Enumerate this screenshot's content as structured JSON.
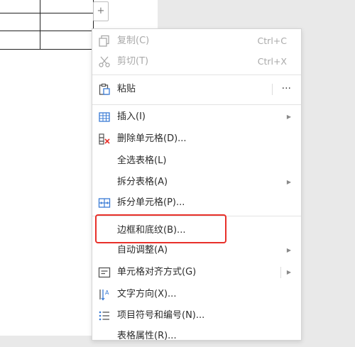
{
  "document": {
    "add_col_label": "+"
  },
  "context_menu": {
    "items": [
      {
        "label": "复制(C)",
        "shortcut": "Ctrl+C"
      },
      {
        "label": "剪切(T)",
        "shortcut": "Ctrl+X"
      },
      {
        "label": "粘贴",
        "more": "···"
      },
      {
        "label": "插入(I)"
      },
      {
        "label": "删除单元格(D)..."
      },
      {
        "label": "全选表格(L)"
      },
      {
        "label": "拆分表格(A)"
      },
      {
        "label": "拆分单元格(P)..."
      },
      {
        "label": "边框和底纹(B)..."
      },
      {
        "label": "自动调整(A)"
      },
      {
        "label": "单元格对齐方式(G)"
      },
      {
        "label": "文字方向(X)..."
      },
      {
        "label": "项目符号和编号(N)..."
      },
      {
        "label": "表格属性(R)..."
      }
    ],
    "submenu_arrow": "▶"
  },
  "colors": {
    "highlight": "#e8302a",
    "disabled_text": "#a9a9a9",
    "delete_icon_accent": "#e8302a"
  }
}
